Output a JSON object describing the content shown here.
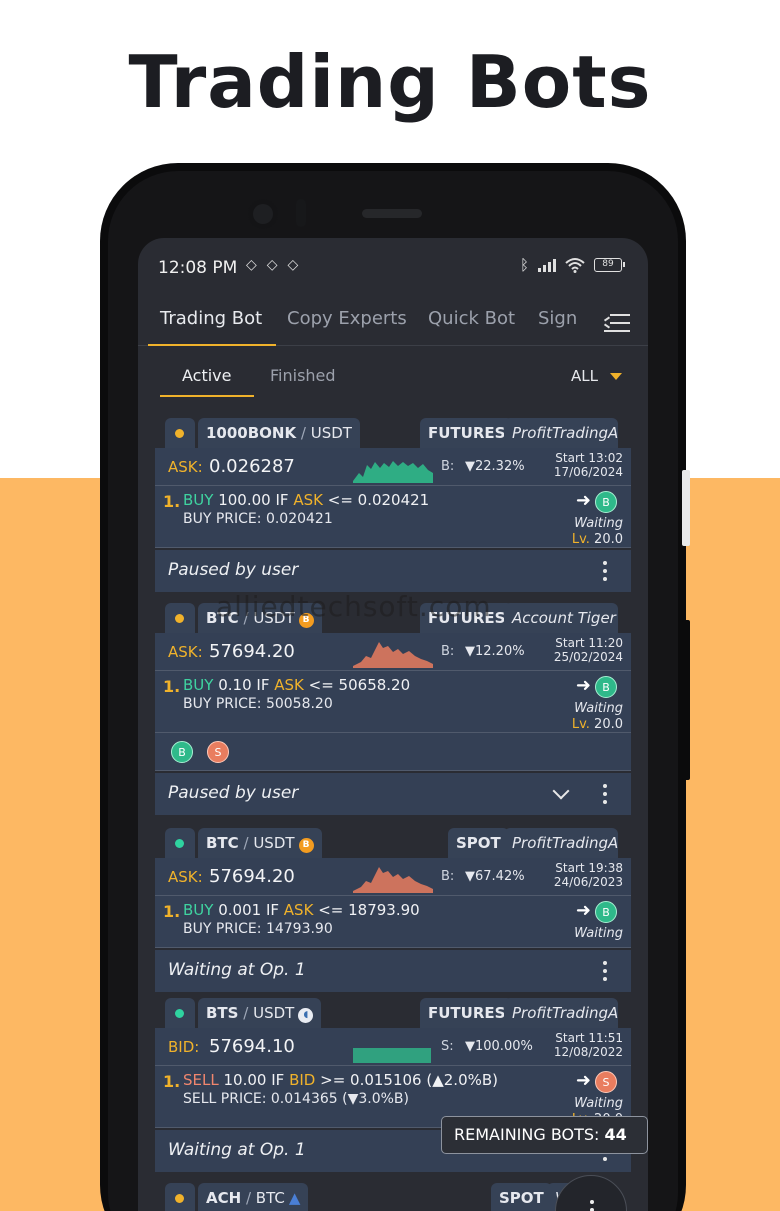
{
  "headline": "Trading Bots",
  "status": {
    "time": "12:08 PM",
    "left_icons": "◇◇◇",
    "battery": "89",
    "bluetooth": "bluetooth-icon",
    "wifi": "wifi-icon"
  },
  "nav": {
    "tabs": [
      "Trading Bot",
      "Copy Experts",
      "Quick Bot",
      "Sign"
    ],
    "active": "Trading Bot"
  },
  "subtabs": {
    "active": "Active",
    "finished": "Finished",
    "filter": "ALL"
  },
  "cards": [
    {
      "status_color": "#f0b22b",
      "pair_base": "1000BONK",
      "pair_sep": "/",
      "pair_quote": "USDT",
      "coin": "",
      "market": "FUTURES",
      "account": "ProfitTradingA.",
      "price_label": "ASK:",
      "price": "0.026287",
      "side_label": "B:",
      "pct": "▼22.32%",
      "start_time": "Start 13:02",
      "start_date": "17/06/2024",
      "spark_color": "#2fb98a",
      "op_num": "1.",
      "op_side": "BUY",
      "op_amount": "100.00",
      "op_if": "IF",
      "op_ref": "ASK",
      "op_cond": "<= 0.020421",
      "op_price_line": "BUY PRICE: 0.020421",
      "op_badge": "B",
      "op_state": "Waiting",
      "lv_label": "Lv.",
      "lv": "20.0",
      "footer": "Paused by user"
    },
    {
      "status_color": "#f0b22b",
      "pair_base": "BTC",
      "pair_sep": "/",
      "pair_quote": "USDT",
      "coin": "B",
      "market": "FUTURES",
      "account": "Account Tiger",
      "price_label": "ASK:",
      "price": "57694.20",
      "side_label": "B:",
      "pct": "▼12.20%",
      "start_time": "Start 11:20",
      "start_date": "25/02/2024",
      "spark_color": "#e97d5f",
      "op_num": "1.",
      "op_side": "BUY",
      "op_amount": "0.10",
      "op_if": "IF",
      "op_ref": "ASK",
      "op_cond": "<= 50658.20",
      "op_price_line": "BUY PRICE: 50058.20",
      "op_badge": "B",
      "op_state": "Waiting",
      "lv_label": "Lv.",
      "lv": "20.0",
      "chips": [
        "B",
        "S"
      ],
      "footer": "Paused by user"
    },
    {
      "status_color": "#2fd3a0",
      "pair_base": "BTC",
      "pair_sep": "/",
      "pair_quote": "USDT",
      "coin": "B",
      "market": "SPOT",
      "account": "ProfitTradingA.",
      "price_label": "ASK:",
      "price": "57694.20",
      "side_label": "B:",
      "pct": "▼67.42%",
      "start_time": "Start 19:38",
      "start_date": "24/06/2023",
      "spark_color": "#e97d5f",
      "op_num": "1.",
      "op_side": "BUY",
      "op_amount": "0.001",
      "op_if": "IF",
      "op_ref": "ASK",
      "op_cond": "<= 18793.90",
      "op_price_line": "BUY PRICE: 14793.90",
      "op_badge": "B",
      "op_state": "Waiting",
      "footer": "Waiting at Op. 1"
    },
    {
      "status_color": "#2fd3a0",
      "pair_base": "BTS",
      "pair_sep": "/",
      "pair_quote": "USDT",
      "coin": "",
      "market": "FUTURES",
      "account": "ProfitTradingA.",
      "price_label": "BID:",
      "price": "57694.10",
      "side_label": "S:",
      "pct": "▼100.00%",
      "start_time": "Start 11:51",
      "start_date": "12/08/2022",
      "spark_color": "#2fb98a",
      "op_num": "1.",
      "op_side": "SELL",
      "op_amount": "10.00",
      "op_if": "IF",
      "op_ref": "BID",
      "op_cond": ">= 0.015106 (▲2.0%B)",
      "op_price_line": "SELL PRICE: 0.014365 (▼3.0%B)",
      "op_badge": "S",
      "op_state": "Waiting",
      "lv_label": "Lv.",
      "lv": "20.0",
      "footer": "Waiting at Op. 1"
    },
    {
      "status_color": "#f0b22b",
      "pair_base": "ACH",
      "pair_sep": "/",
      "pair_quote": "BTC",
      "market": "SPOT",
      "account": "V"
    }
  ],
  "watermark": "alliedtechsoft.com",
  "remaining_label": "REMAINING BOTS:",
  "remaining_count": "44",
  "colors": {
    "accent": "#f0b22b",
    "buy": "#3fd3a0",
    "sell": "#f0866e",
    "panel": "#344055"
  }
}
